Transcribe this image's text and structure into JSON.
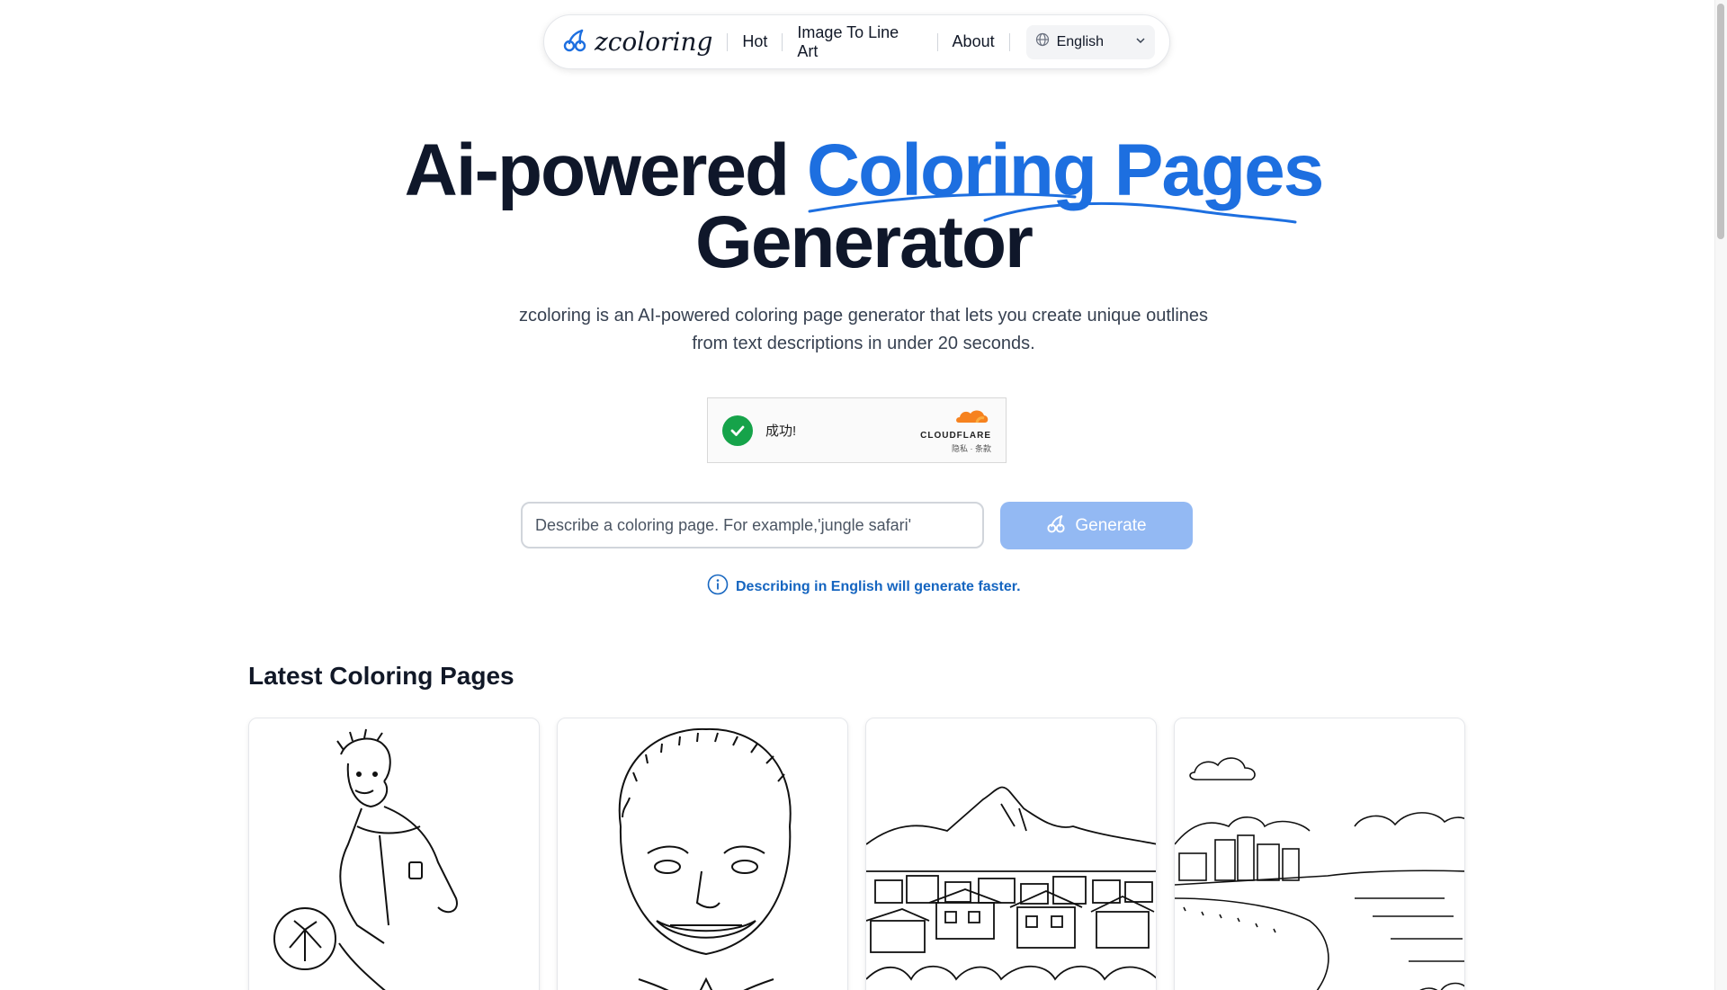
{
  "nav": {
    "logo_text": "zcoloring",
    "links": [
      "Hot",
      "Image To Line Art",
      "About"
    ],
    "language": "English"
  },
  "hero": {
    "title_part1": "Ai-powered ",
    "title_accent": "Coloring Pages",
    "title_line2": "Generator",
    "subtitle": "zcoloring is an AI-powered coloring page generator that lets you create unique outlines from text descriptions in under 20 seconds."
  },
  "captcha": {
    "status": "成功!",
    "brand": "CLOUDFLARE",
    "links": "隐私 · 条款"
  },
  "prompt": {
    "placeholder": "Describe a coloring page. For example,'jungle safari'",
    "button_label": "Generate",
    "hint": "Describing in English will generate faster."
  },
  "latest": {
    "title": "Latest Coloring Pages"
  },
  "colors": {
    "accent": "#1d6fe0",
    "button": "#93b9f3",
    "hint": "#1565c0"
  }
}
